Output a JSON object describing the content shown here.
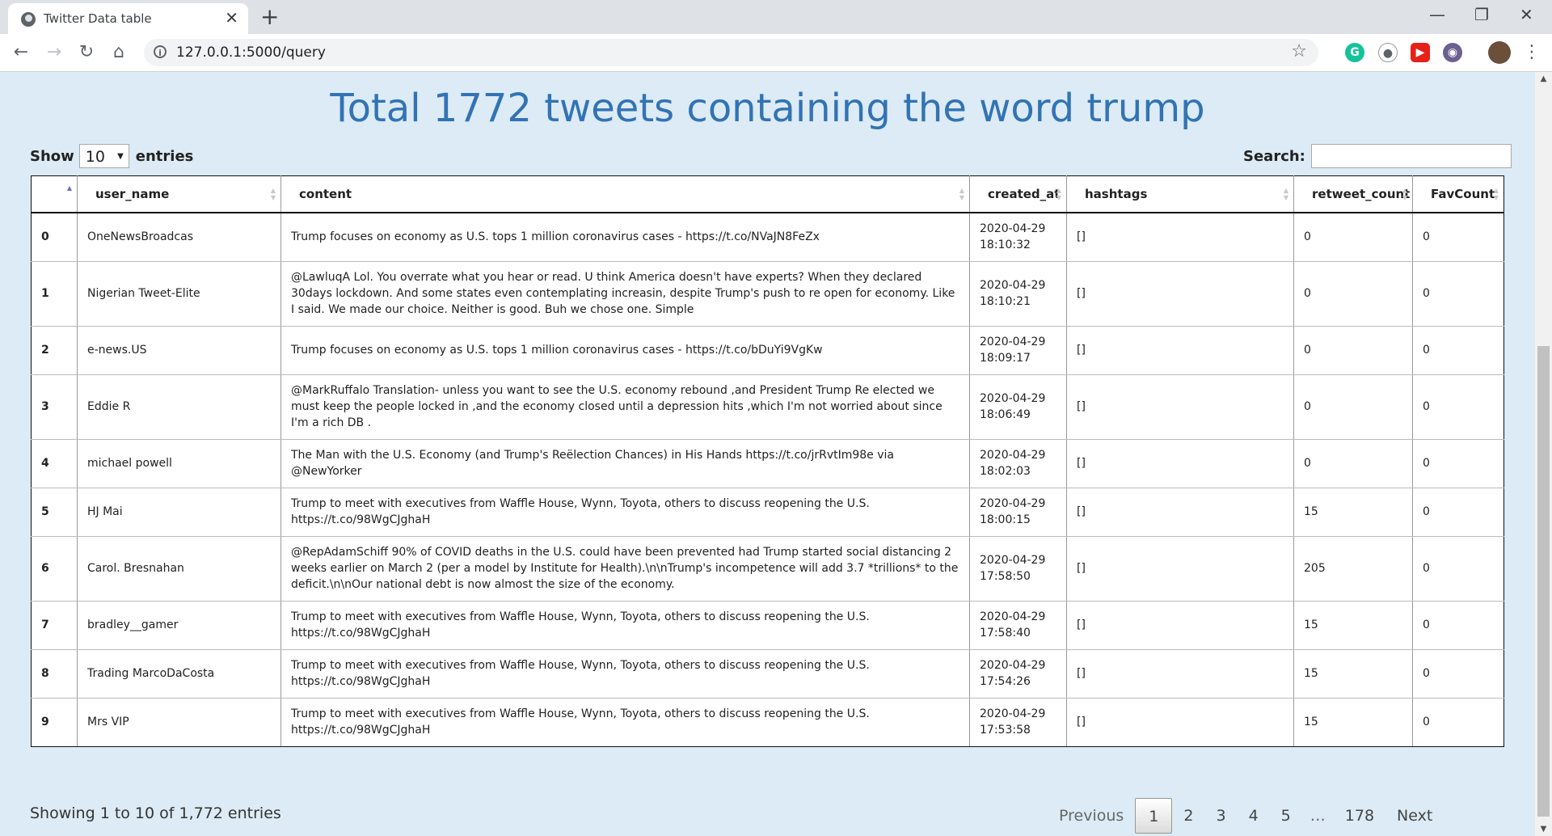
{
  "browser": {
    "tab_title": "Twitter Data table",
    "url": "127.0.0.1:5000/query",
    "tab_close": "✕",
    "new_tab": "+"
  },
  "page": {
    "title": "Total 1772 tweets containing the word trump",
    "length": {
      "show": "Show",
      "value": "10",
      "entries": "entries"
    },
    "search_label": "Search:",
    "search_value": ""
  },
  "table": {
    "columns": [
      "",
      "user_name",
      "content",
      "created_at",
      "hashtags",
      "retweet_count",
      "FavCount"
    ],
    "rows": [
      {
        "idx": "0",
        "user": "OneNewsBroadcas",
        "content": "Trump focuses on economy as U.S. tops 1 million coronavirus cases - https://t.co/NVaJN8FeZx",
        "date": "2020-04-29",
        "time": "18:10:32",
        "hashtags": "[]",
        "retweets": "0",
        "favs": "0"
      },
      {
        "idx": "1",
        "user": "Nigerian Tweet-Elite",
        "content": "@LawluqA Lol. You overrate what you hear or read. U think America doesn't have experts? When they declared 30days lockdown. And some states even contemplating increasin, despite Trump's push to re open for economy. Like I said. We made our choice. Neither is good. Buh we chose one. Simple",
        "date": "2020-04-29",
        "time": "18:10:21",
        "hashtags": "[]",
        "retweets": "0",
        "favs": "0"
      },
      {
        "idx": "2",
        "user": "e-news.US",
        "content": "Trump focuses on economy as U.S. tops 1 million coronavirus cases - https://t.co/bDuYi9VgKw",
        "date": "2020-04-29",
        "time": "18:09:17",
        "hashtags": "[]",
        "retweets": "0",
        "favs": "0"
      },
      {
        "idx": "3",
        "user": "Eddie R",
        "content": "@MarkRuffalo Translation- unless you want to see the U.S. economy rebound ,and President Trump Re elected we must keep the people locked in ,and the economy closed until a depression hits ,which I'm not worried about since I'm a rich DB .",
        "date": "2020-04-29",
        "time": "18:06:49",
        "hashtags": "[]",
        "retweets": "0",
        "favs": "0"
      },
      {
        "idx": "4",
        "user": "michael powell",
        "content": "The Man with the U.S. Economy (and Trump's Reëlection Chances) in His Hands https://t.co/jrRvtIm98e via @NewYorker",
        "date": "2020-04-29",
        "time": "18:02:03",
        "hashtags": "[]",
        "retweets": "0",
        "favs": "0"
      },
      {
        "idx": "5",
        "user": "HJ Mai",
        "content": "Trump to meet with executives from Waffle House, Wynn, Toyota, others to discuss reopening the U.S. https://t.co/98WgCJghaH",
        "date": "2020-04-29",
        "time": "18:00:15",
        "hashtags": "[]",
        "retweets": "15",
        "favs": "0"
      },
      {
        "idx": "6",
        "user": "Carol. Bresnahan",
        "content": "@RepAdamSchiff 90% of COVID deaths in the U.S. could have been prevented had Trump started social distancing 2 weeks earlier on March 2 (per a model by Institute for Health).\\n\\nTrump's incompetence will add 3.7 *trillions* to the deficit.\\n\\nOur national debt is now almost the size of the economy.",
        "date": "2020-04-29",
        "time": "17:58:50",
        "hashtags": "[]",
        "retweets": "205",
        "favs": "0"
      },
      {
        "idx": "7",
        "user": "bradley__gamer",
        "content": "Trump to meet with executives from Waffle House, Wynn, Toyota, others to discuss reopening the U.S. https://t.co/98WgCJghaH",
        "date": "2020-04-29",
        "time": "17:58:40",
        "hashtags": "[]",
        "retweets": "15",
        "favs": "0"
      },
      {
        "idx": "8",
        "user": "Trading MarcoDaCosta",
        "content": "Trump to meet with executives from Waffle House, Wynn, Toyota, others to discuss reopening the U.S. https://t.co/98WgCJghaH",
        "date": "2020-04-29",
        "time": "17:54:26",
        "hashtags": "[]",
        "retweets": "15",
        "favs": "0"
      },
      {
        "idx": "9",
        "user": "Mrs VIP",
        "content": "Trump to meet with executives from Waffle House, Wynn, Toyota, others to discuss reopening the U.S. https://t.co/98WgCJghaH",
        "date": "2020-04-29",
        "time": "17:53:58",
        "hashtags": "[]",
        "retweets": "15",
        "favs": "0"
      }
    ]
  },
  "footer": {
    "info": "Showing 1 to 10 of 1,772 entries",
    "pagination": {
      "previous": "Previous",
      "pages": [
        "1",
        "2",
        "3",
        "4",
        "5"
      ],
      "ellipsis": "…",
      "last": "178",
      "next": "Next",
      "current": "1"
    }
  },
  "colors": {
    "page_bg": "#dcebf5",
    "title": "#3273b4",
    "sort_active": "#6b6bd8"
  }
}
